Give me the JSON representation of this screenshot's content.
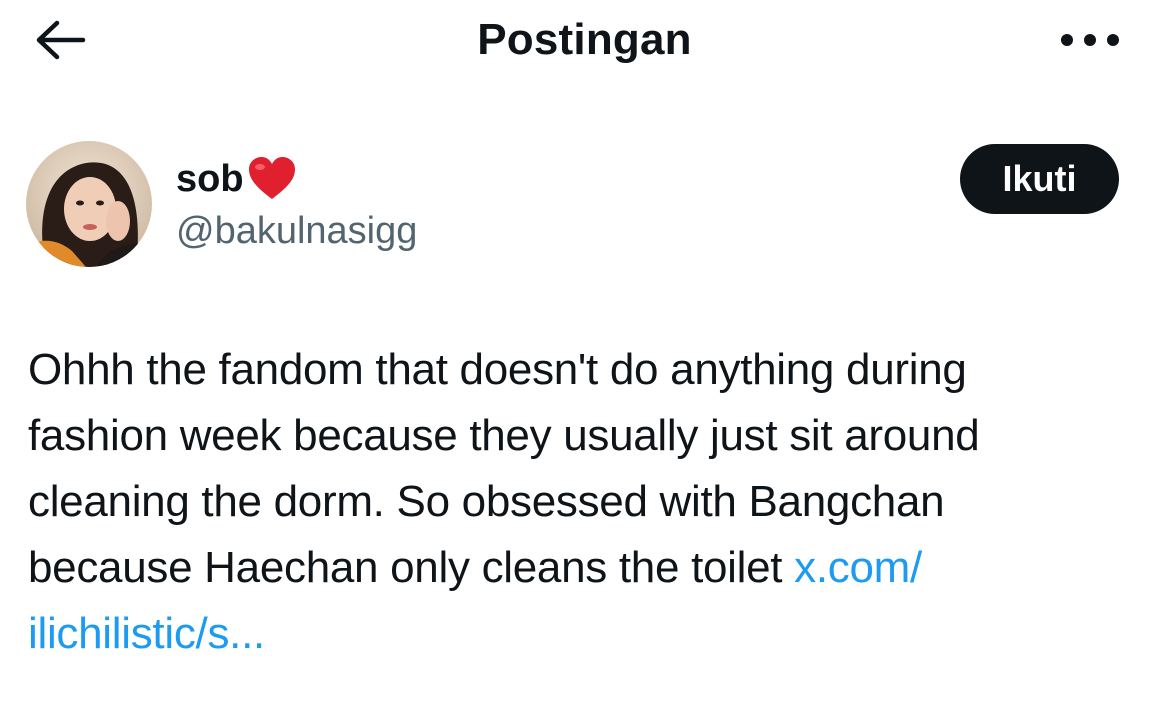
{
  "header": {
    "title": "Postingan",
    "back_icon": "arrow-left-icon",
    "more_icon": "more-horizontal-icon"
  },
  "author": {
    "name": "sob",
    "name_emoji": "heart-icon",
    "handle": "@bakulnasigg",
    "follow_label": "Ikuti"
  },
  "post": {
    "line1": "Ohhh the fandom that doesn't do anything during",
    "line2": "fashion week because they usually just sit around",
    "line3": "cleaning the dorm. So obsessed with Bangchan",
    "line4_text": "because Haechan only cleans the toilet ",
    "link_part1": "x.com/",
    "link_part2": "ilichilistic/s..."
  },
  "colors": {
    "text": "#0f1419",
    "secondary": "#536471",
    "link": "#1d9bf0",
    "button_bg": "#0f1419",
    "heart": "#e0202e"
  }
}
